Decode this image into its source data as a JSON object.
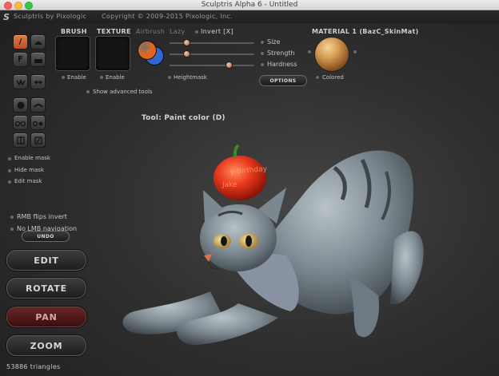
{
  "window": {
    "title": "Sculptris Alpha 6 - Untitled"
  },
  "app": {
    "logo": "S",
    "name": "Sculptris by Pixologic",
    "copyright": "Copyright © 2009-2015 Pixologic, Inc."
  },
  "brush_panel": {
    "brush_label": "BRUSH",
    "texture_label": "TEXTURE",
    "airbrush_label": "Airbrush",
    "lazy_label": "Lazy",
    "invert_label": "Invert [X]",
    "enable_brush": "Enable",
    "enable_texture": "Enable",
    "heightmask": "Heightmask",
    "show_advanced": "Show advanced tools",
    "size_label": "Size",
    "strength_label": "Strength",
    "hardness_label": "Hardness",
    "size_value": 0.2,
    "strength_value": 0.2,
    "hardness_value": 0.7,
    "options_label": "OPTIONS",
    "primary_color": "#e0661e",
    "secondary_color": "#2f66d6"
  },
  "material": {
    "label": "MATERIAL 1 (BazC_SkinMat)",
    "colored_label": "Colored"
  },
  "tool_status": "Tool: Paint color (D)",
  "left_options": {
    "enable_mask": "Enable mask",
    "hide_mask": "Hide mask",
    "edit_mask": "Edit mask",
    "rmb_flips": "RMB flips invert",
    "no_lmb": "No LMB navigation",
    "undo": "UNDO"
  },
  "modes": {
    "edit": "EDIT",
    "rotate": "ROTATE",
    "pan": "PAN",
    "zoom": "ZOOM"
  },
  "status": {
    "triangles": "53886 triangles"
  },
  "icons": {
    "paint": "brush-icon",
    "flatten": "flatten-icon",
    "grab": "grab-icon",
    "crease": "crease-icon",
    "pinch": "pinch-icon",
    "smooth": "smooth-icon",
    "symmetry": "symmetry-icon"
  }
}
